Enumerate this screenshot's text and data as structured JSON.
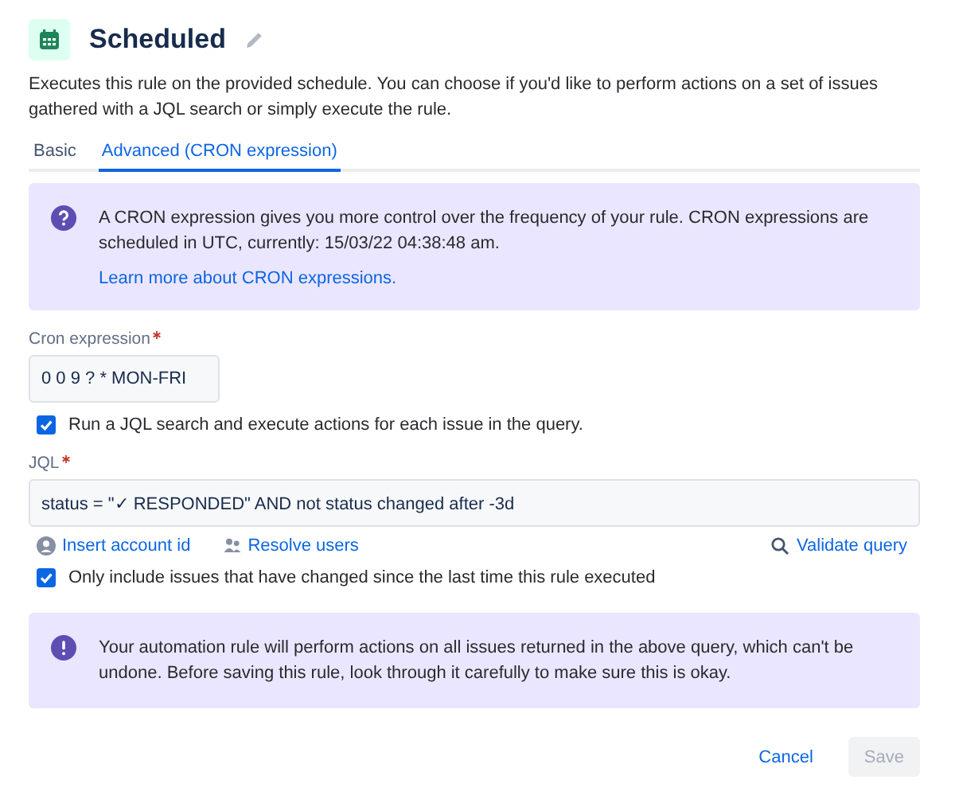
{
  "header": {
    "title": "Scheduled",
    "description": "Executes this rule on the provided schedule. You can choose if you'd like to perform actions on a set of issues gathered with a JQL search or simply execute the rule."
  },
  "tabs": [
    {
      "label": "Basic",
      "selected": false
    },
    {
      "label": "Advanced (CRON expression)",
      "selected": true
    }
  ],
  "info_panel": {
    "kind": "info",
    "text": "A CRON expression gives you more control over the frequency of your rule. CRON expressions are scheduled in UTC, currently: 15/03/22 04:38:48 am.",
    "link": "Learn more about CRON expressions."
  },
  "cron_field": {
    "label": "Cron expression",
    "required": true,
    "value": "0 0 9 ? * MON-FRI"
  },
  "jql_checkbox": {
    "label": "Run a JQL search and execute actions for each issue in the query.",
    "checked": true
  },
  "jql_field": {
    "label": "JQL",
    "required": true,
    "value": "status = \"✓ RESPONDED\" AND not status changed after -3d"
  },
  "jql_links": [
    {
      "kind": "account",
      "label": "Insert account id"
    },
    {
      "kind": "users",
      "label": "Resolve users"
    },
    {
      "kind": "validate",
      "label": "Validate query"
    }
  ],
  "changed_checkbox": {
    "label": "Only include issues that have changed since the last time this rule executed",
    "checked": true
  },
  "warning_panel": {
    "kind": "warning",
    "text": "Your automation rule will perform actions on all issues returned in the above query, which can't be undone. Before saving this rule, look through it carefully to make sure this is okay."
  },
  "buttons": [
    {
      "kind": "link",
      "label": "Cancel",
      "disabled": false
    },
    {
      "kind": "primary",
      "label": "Save",
      "disabled": true
    }
  ]
}
